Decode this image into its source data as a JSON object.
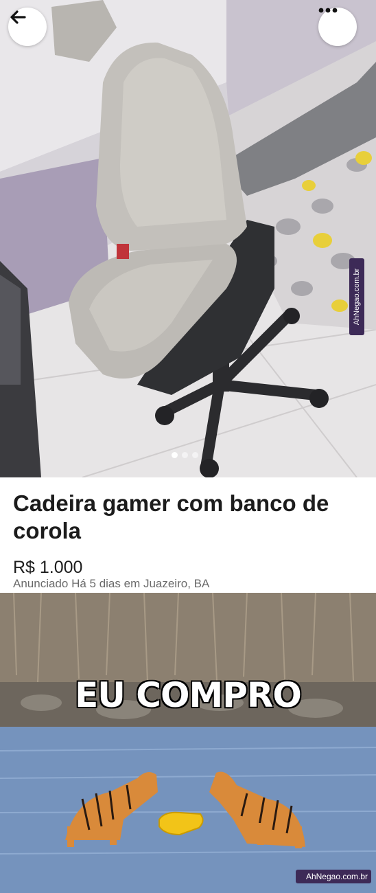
{
  "listing": {
    "title": "Cadeira gamer  com banco de corola",
    "price": "R$ 1.000",
    "meta": "Anunciado Há 5 dias em Juazeiro, BA",
    "photo_count": 3,
    "active_photo_index": 0
  },
  "nav": {
    "back_icon": "arrow-left-icon",
    "more_icon": "ellipsis-icon"
  },
  "meme": {
    "caption": "EU COMPRO"
  },
  "watermarks": {
    "vertical": "AhNegao.com.br",
    "horizontal": "AhNegao.com.br"
  },
  "colors": {
    "title": "#1c1c1c",
    "meta": "#6a6a6a",
    "watermark_bg": "#3d2a57"
  }
}
